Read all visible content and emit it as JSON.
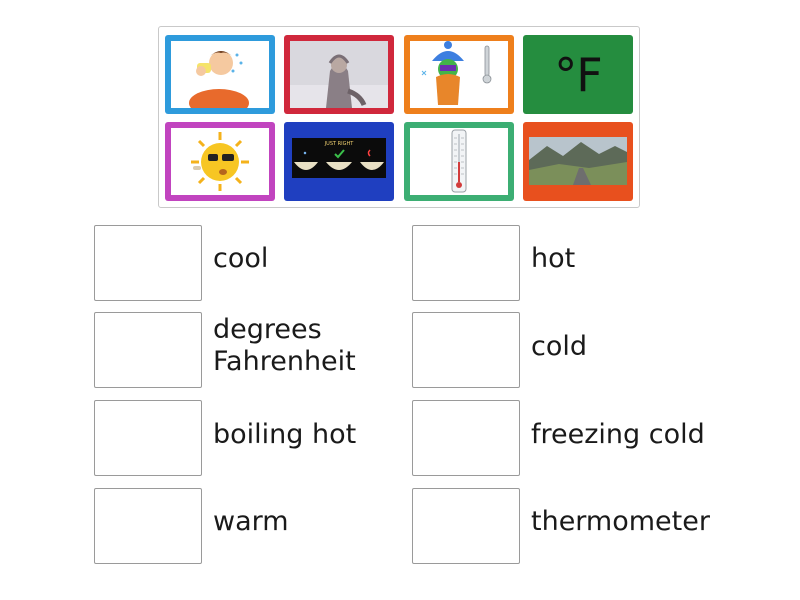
{
  "tray": {
    "cards": [
      {
        "name": "card-hot-man",
        "icon": "sweating-man-image",
        "color": "#2e9bdc"
      },
      {
        "name": "card-cold-person",
        "icon": "bundled-person-in-snow-image",
        "color": "#d0283c"
      },
      {
        "name": "card-freezing-character",
        "icon": "frozen-character-with-thermometer-image",
        "color": "#ee7f1c"
      },
      {
        "name": "card-degrees-fahrenheit",
        "icon": "fahrenheit-symbol",
        "color": "#258d3f",
        "text": "°F"
      },
      {
        "name": "card-sun",
        "icon": "sun-with-sunglasses-image",
        "color": "#c144bf"
      },
      {
        "name": "card-just-right-bowls",
        "icon": "just-right-bowls-image",
        "color": "#1f3fc0",
        "caption": "JUST RIGHT"
      },
      {
        "name": "card-thermometer",
        "icon": "thermometer-image",
        "color": "#3cae73"
      },
      {
        "name": "card-landscape",
        "icon": "mountain-road-landscape-image",
        "color": "#e8501e"
      }
    ]
  },
  "targets": [
    {
      "label": "cool"
    },
    {
      "label": "hot"
    },
    {
      "label_line1": "degrees",
      "label_line2": "Fahrenheit"
    },
    {
      "label": "cold"
    },
    {
      "label": "boiling hot"
    },
    {
      "label": "freezing cold"
    },
    {
      "label": "warm"
    },
    {
      "label": "thermometer"
    }
  ]
}
